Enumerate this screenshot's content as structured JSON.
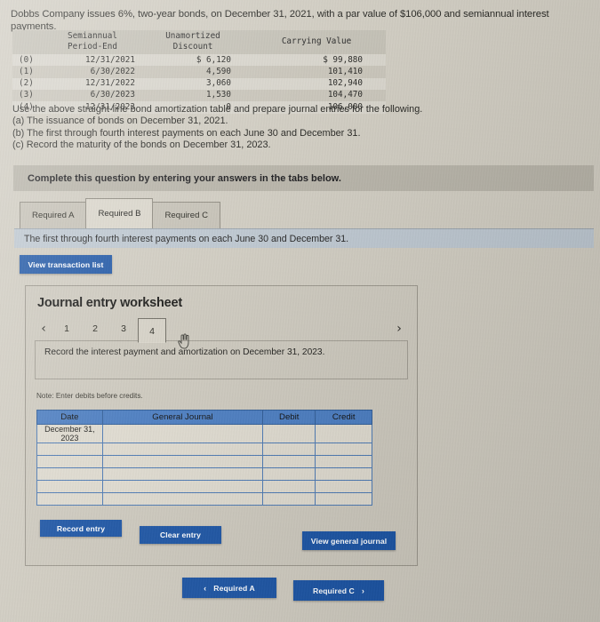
{
  "problem": {
    "intro": "Dobbs Company issues 6%, two-year bonds, on December 31, 2021, with a par value of $106,000 and semiannual interest payments.",
    "amortization_table": {
      "headers": [
        "",
        "Semiannual Period-End",
        "Unamortized Discount",
        "Carrying Value"
      ],
      "rows": [
        {
          "index": "(0)",
          "period_end": "12/31/2021",
          "unamortized_discount": "$ 6,120",
          "carrying_value": "$ 99,880"
        },
        {
          "index": "(1)",
          "period_end": "6/30/2022",
          "unamortized_discount": "4,590",
          "carrying_value": "101,410"
        },
        {
          "index": "(2)",
          "period_end": "12/31/2022",
          "unamortized_discount": "3,060",
          "carrying_value": "102,940"
        },
        {
          "index": "(3)",
          "period_end": "6/30/2023",
          "unamortized_discount": "1,530",
          "carrying_value": "104,470"
        },
        {
          "index": "(4)",
          "period_end": "12/31/2023",
          "unamortized_discount": "0",
          "carrying_value": "106,000"
        }
      ]
    },
    "instructions": {
      "lead": "Use the above straight-line bond amortization table and prepare journal entries for the following.",
      "a": "(a) The issuance of bonds on December 31, 2021.",
      "b": "(b) The first through fourth interest payments on each June 30 and December 31.",
      "c": "(c) Record the maturity of the bonds on December 31, 2023."
    }
  },
  "banner": {
    "text": "Complete this question by entering your answers in the tabs below."
  },
  "tabs": [
    {
      "label": "Required A",
      "active": false
    },
    {
      "label": "Required B",
      "active": true
    },
    {
      "label": "Required C",
      "active": false
    }
  ],
  "subbar": {
    "text": "The first through fourth interest payments on each June 30 and December 31."
  },
  "buttons": {
    "view_transaction_list": "View transaction list",
    "record_entry": "Record entry",
    "clear_entry": "Clear entry",
    "view_general_journal": "View general journal",
    "nav_prev": "Required A",
    "nav_next": "Required C",
    "chevron_left": "‹",
    "chevron_right": "›"
  },
  "worksheet": {
    "title": "Journal entry worksheet",
    "nav_prev_arrow": "‹",
    "nav_next_arrow": "›",
    "pages": [
      {
        "label": "1",
        "active": false
      },
      {
        "label": "2",
        "active": false
      },
      {
        "label": "3",
        "active": false
      },
      {
        "label": "4",
        "active": true
      }
    ],
    "prompt": "Record the interest payment and amortization on December 31, 2023.",
    "note": "Note: Enter debits before credits.",
    "journal": {
      "headers": [
        "Date",
        "General Journal",
        "Debit",
        "Credit"
      ],
      "rows": [
        {
          "date": "December 31,\n2023",
          "general_journal": "",
          "debit": "",
          "credit": ""
        },
        {
          "date": "",
          "general_journal": "",
          "debit": "",
          "credit": ""
        },
        {
          "date": "",
          "general_journal": "",
          "debit": "",
          "credit": ""
        },
        {
          "date": "",
          "general_journal": "",
          "debit": "",
          "credit": ""
        },
        {
          "date": "",
          "general_journal": "",
          "debit": "",
          "credit": ""
        },
        {
          "date": "",
          "general_journal": "",
          "debit": "",
          "credit": ""
        }
      ]
    }
  },
  "colors": {
    "page_bg": "#cfcbc0",
    "banner_bg": "#b6b2a7",
    "subbar_bg": "#bcc6cf",
    "button_blue": "#1d55a4",
    "table_header_blue": "#4a7cc0"
  }
}
